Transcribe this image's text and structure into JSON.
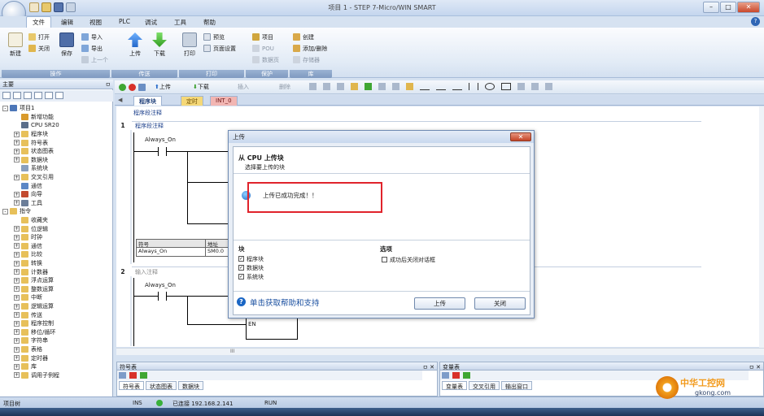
{
  "window": {
    "title": "项目 1 - STEP 7-Micro/WIN SMART",
    "help": "?",
    "min": "–",
    "max": "□",
    "close": "✕"
  },
  "menu": [
    "文件",
    "编辑",
    "视图",
    "PLC",
    "调试",
    "工具",
    "帮助"
  ],
  "ribbon": {
    "groups": [
      {
        "label": "操作",
        "big": [
          {
            "label": "新建"
          },
          {
            "label": "保存"
          }
        ],
        "small": [
          "打开",
          "关闭"
        ]
      },
      {
        "label": "传送",
        "big": [
          {
            "label": "上传"
          },
          {
            "label": "下载"
          }
        ],
        "small": [
          "导入",
          "导出",
          "上一个"
        ]
      },
      {
        "label": "打印",
        "big": [
          {
            "label": "打印"
          }
        ],
        "small": [
          "预览",
          "页面设置"
        ]
      },
      {
        "label": "保护",
        "small": [
          "项目",
          "POU",
          "数据页"
        ]
      },
      {
        "label": "库",
        "small": [
          "创建",
          "添加/删除",
          "存储器"
        ]
      }
    ]
  },
  "left_pane": {
    "title": "主要",
    "pin": "ㅁ",
    "tree": [
      {
        "label": "项目1",
        "level": 0,
        "exp": "-",
        "color": "#4c76b8"
      },
      {
        "label": "新增功能",
        "level": 1,
        "exp": "",
        "color": "#d99a2b"
      },
      {
        "label": "CPU SR20",
        "level": 1,
        "exp": "",
        "color": "#5b6e89"
      },
      {
        "label": "程序块",
        "level": 1,
        "exp": "+",
        "color": "#e7c05a"
      },
      {
        "label": "符号表",
        "level": 1,
        "exp": "+",
        "color": "#e7c05a"
      },
      {
        "label": "状态图表",
        "level": 1,
        "exp": "+",
        "color": "#e7c05a"
      },
      {
        "label": "数据块",
        "level": 1,
        "exp": "+",
        "color": "#e7c05a"
      },
      {
        "label": "系统块",
        "level": 1,
        "exp": "",
        "color": "#8aa0bf"
      },
      {
        "label": "交叉引用",
        "level": 1,
        "exp": "+",
        "color": "#e7c05a"
      },
      {
        "label": "通信",
        "level": 1,
        "exp": "",
        "color": "#5b87c6"
      },
      {
        "label": "向导",
        "level": 1,
        "exp": "+",
        "color": "#c34a2e"
      },
      {
        "label": "工具",
        "level": 1,
        "exp": "+",
        "color": "#6c7e99"
      },
      {
        "label": "指令",
        "level": 0,
        "exp": "-",
        "color": "#e7c05a"
      },
      {
        "label": "收藏夹",
        "level": 1,
        "exp": "",
        "color": "#e7c05a"
      },
      {
        "label": "位逻辑",
        "level": 1,
        "exp": "+",
        "color": "#e7c05a"
      },
      {
        "label": "时钟",
        "level": 1,
        "exp": "+",
        "color": "#e7c05a"
      },
      {
        "label": "通信",
        "level": 1,
        "exp": "+",
        "color": "#e7c05a"
      },
      {
        "label": "比较",
        "level": 1,
        "exp": "+",
        "color": "#e7c05a"
      },
      {
        "label": "转换",
        "level": 1,
        "exp": "+",
        "color": "#e7c05a"
      },
      {
        "label": "计数器",
        "level": 1,
        "exp": "+",
        "color": "#e7c05a"
      },
      {
        "label": "浮点运算",
        "level": 1,
        "exp": "+",
        "color": "#e7c05a"
      },
      {
        "label": "整数运算",
        "level": 1,
        "exp": "+",
        "color": "#e7c05a"
      },
      {
        "label": "中断",
        "level": 1,
        "exp": "+",
        "color": "#e7c05a"
      },
      {
        "label": "逻辑运算",
        "level": 1,
        "exp": "+",
        "color": "#e7c05a"
      },
      {
        "label": "传送",
        "level": 1,
        "exp": "+",
        "color": "#e7c05a"
      },
      {
        "label": "程序控制",
        "level": 1,
        "exp": "+",
        "color": "#e7c05a"
      },
      {
        "label": "移位/循环",
        "level": 1,
        "exp": "+",
        "color": "#e7c05a"
      },
      {
        "label": "字符串",
        "level": 1,
        "exp": "+",
        "color": "#e7c05a"
      },
      {
        "label": "表格",
        "level": 1,
        "exp": "+",
        "color": "#e7c05a"
      },
      {
        "label": "定时器",
        "level": 1,
        "exp": "+",
        "color": "#e7c05a"
      },
      {
        "label": "库",
        "level": 1,
        "exp": "+",
        "color": "#e7c05a"
      },
      {
        "label": "调用子例程",
        "level": 1,
        "exp": "+",
        "color": "#e7c05a"
      }
    ]
  },
  "editor": {
    "toolbar_labels": {
      "upload": "上传",
      "download": "下载",
      "insert": "插入",
      "delete": "删除"
    },
    "tabs": [
      "程序块",
      "定时",
      "INT_0"
    ],
    "network1": {
      "num": "1",
      "title": "程序段注释",
      "comment": "程序段注释",
      "contact": "Always_On"
    },
    "symbol_info": {
      "h1": "符号",
      "h2": "地址",
      "v1": "Always_On",
      "v2": "SM0.0"
    },
    "network2": {
      "num": "2",
      "comment": "输入注释",
      "contact": "Always_On",
      "en": "EN"
    },
    "scroll_mark": "III"
  },
  "dialog": {
    "title": "上传",
    "close": "✕",
    "heading": "从 CPU 上传块",
    "subheading": "选择要上传的块",
    "message": "上传已成功完成！！",
    "blocks_label": "块",
    "blocks": [
      {
        "label": "程序块",
        "checked": true
      },
      {
        "label": "数据块",
        "checked": true
      },
      {
        "label": "系统块",
        "checked": true
      }
    ],
    "options_label": "选项",
    "option": {
      "label": "成功后关闭对话框",
      "checked": false
    },
    "help_link": "单击获取帮助和支持",
    "upload_btn": "上传",
    "close_btn": "关闭"
  },
  "symbol_panel": {
    "title": "符号表",
    "pin": "ㅁ ✕",
    "tabs": [
      "符号表",
      "状态图表",
      "数据块"
    ]
  },
  "var_panel": {
    "title": "变量表",
    "pin": "ㅁ ✕",
    "tabs": [
      "变量表",
      "交叉引用",
      "输出窗口"
    ]
  },
  "status": {
    "left": "项目树",
    "mode": "INS",
    "connection": "已连接 192.168.2.141",
    "run": "RUN"
  },
  "watermark": {
    "name": "中华工控网",
    "url": "gkong.com"
  },
  "colors": {
    "accent": "#1e5fb3",
    "highlight": "#e0232b",
    "ribbon_group": "#7f9ac0"
  }
}
